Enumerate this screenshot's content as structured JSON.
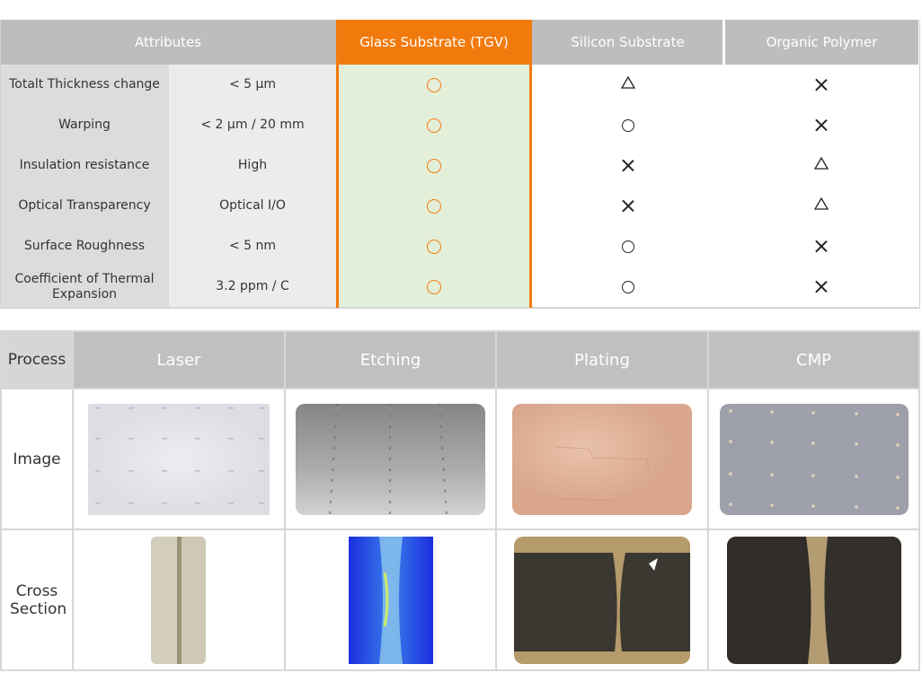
{
  "comparison_table": {
    "headers": {
      "attributes": "Attributes",
      "glass": "Glass Substrate (TGV)",
      "silicon": "Silicon Substrate",
      "organic": "Organic Polymer"
    },
    "rows": [
      {
        "attribute": "Totalt Thickness change",
        "value": "< 5 μm",
        "glass": "circle",
        "silicon": "triangle",
        "organic": "cross"
      },
      {
        "attribute": "Warping",
        "value": "< 2 μm / 20 mm",
        "glass": "circle",
        "silicon": "circle",
        "organic": "cross"
      },
      {
        "attribute": "Insulation resistance",
        "value": "High",
        "glass": "circle",
        "silicon": "cross",
        "organic": "triangle"
      },
      {
        "attribute": "Optical Transparency",
        "value": "Optical I/O",
        "glass": "circle",
        "silicon": "cross",
        "organic": "triangle"
      },
      {
        "attribute": "Surface Roughness",
        "value": "< 5 nm",
        "glass": "circle",
        "silicon": "circle",
        "organic": "cross"
      },
      {
        "attribute": "Coefficient of Thermal Expansion",
        "value": "3.2 ppm / C",
        "glass": "circle",
        "silicon": "circle",
        "organic": "cross"
      }
    ],
    "colors": {
      "glass_accent": "#f27a0d",
      "glass_fill": "#e3efd9",
      "header_gray": "#bdbdbd"
    }
  },
  "process_table": {
    "header_label": "Process",
    "steps": [
      "Laser",
      "Etching",
      "Plating",
      "CMP"
    ],
    "row_labels": {
      "image": "Image",
      "cross_section": "Cross Section"
    }
  }
}
